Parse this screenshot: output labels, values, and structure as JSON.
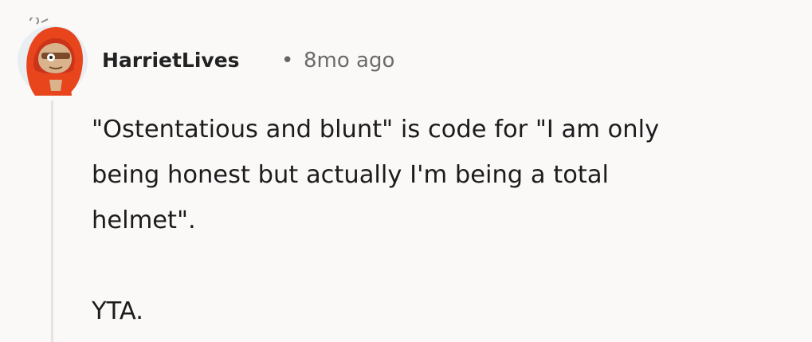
{
  "comment": {
    "author": "HarrietLives",
    "separator": "•",
    "timestamp": "8mo ago",
    "paragraphs": [
      "\"Ostentatious and blunt\" is code for \"I am only\nbeing honest but actually I'm being a total\nhelmet\".",
      "YTA."
    ],
    "avatar_icon": "snoo-avatar-red-hood-icon"
  },
  "colors": {
    "background": "#fbf9f8",
    "thread_line": "#e9e3df",
    "username": "#222222",
    "meta": "#6b6b6b",
    "body_text": "#1c1c1c",
    "avatar_hood": "#e8451c"
  }
}
